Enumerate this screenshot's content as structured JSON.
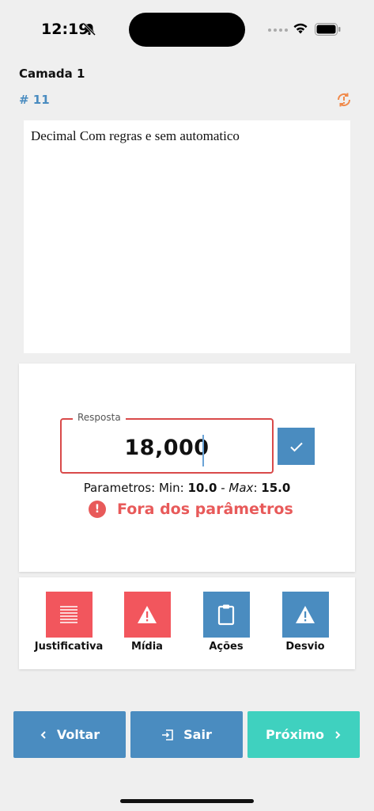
{
  "status_bar": {
    "time": "12:19"
  },
  "header": {
    "layer_title": "Camada 1",
    "layer_number": "# 11"
  },
  "question": {
    "text": "Decimal Com regras e sem automatico"
  },
  "answer": {
    "label": "Resposta",
    "value": "18,000",
    "params_prefix": "Parametros: Min:",
    "min": "10.0",
    "separator": " - ",
    "max_label": "Max",
    "max_colon": ":",
    "max": "15.0",
    "error_text": "Fora dos parâmetros",
    "error_symbol": "!"
  },
  "actions": [
    {
      "label": "Justificativa",
      "icon": "list-lines-icon",
      "color": "#f2565d"
    },
    {
      "label": "Mídia",
      "icon": "warning-icon",
      "color": "#f2565d"
    },
    {
      "label": "Ações",
      "icon": "clipboard-icon",
      "color": "#4a8cc0"
    },
    {
      "label": "Desvio",
      "icon": "warning-icon",
      "color": "#4a8cc0"
    }
  ],
  "nav": {
    "back_label": "Voltar",
    "exit_label": "Sair",
    "next_label": "Próximo",
    "back_color": "#4a8cc0",
    "exit_color": "#4a8cc0",
    "next_color": "#3fd1bf"
  },
  "colors": {
    "accent": "#4a8cc0",
    "error": "#e85a5a",
    "sync": "#f08a4b"
  }
}
